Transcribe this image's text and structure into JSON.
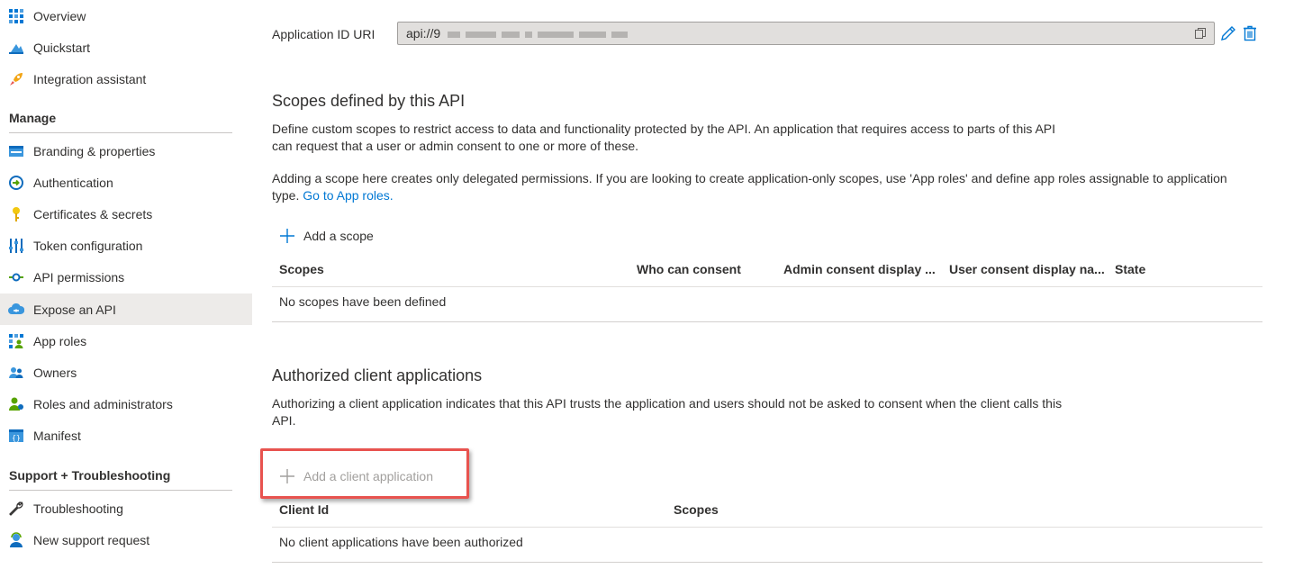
{
  "sidebar": {
    "top_items": [
      {
        "label": "Overview",
        "icon": "overview-icon"
      },
      {
        "label": "Quickstart",
        "icon": "quickstart-icon"
      },
      {
        "label": "Integration assistant",
        "icon": "rocket-icon"
      }
    ],
    "manage_header": "Manage",
    "manage_items": [
      {
        "label": "Branding & properties",
        "icon": "branding-icon"
      },
      {
        "label": "Authentication",
        "icon": "authentication-icon"
      },
      {
        "label": "Certificates & secrets",
        "icon": "key-icon"
      },
      {
        "label": "Token configuration",
        "icon": "token-config-icon"
      },
      {
        "label": "API permissions",
        "icon": "api-permissions-icon"
      },
      {
        "label": "Expose an API",
        "icon": "cloud-api-icon",
        "selected": true
      },
      {
        "label": "App roles",
        "icon": "app-roles-icon"
      },
      {
        "label": "Owners",
        "icon": "owners-icon"
      },
      {
        "label": "Roles and administrators",
        "icon": "roles-admin-icon"
      },
      {
        "label": "Manifest",
        "icon": "manifest-icon"
      }
    ],
    "support_header": "Support + Troubleshooting",
    "support_items": [
      {
        "label": "Troubleshooting",
        "icon": "wrench-icon"
      },
      {
        "label": "New support request",
        "icon": "support-person-icon"
      }
    ]
  },
  "main": {
    "app_id_uri": {
      "label": "Application ID URI",
      "value_prefix": "api://9"
    },
    "scopes": {
      "title": "Scopes defined by this API",
      "description_1": "Define custom scopes to restrict access to data and functionality protected by the API. An application that requires access to parts of this API can request that a user or admin consent to one or more of these.",
      "description_2": "Adding a scope here creates only delegated permissions. If you are looking to create application-only scopes, use 'App roles' and define app roles assignable to application type.",
      "link": "Go to App roles.",
      "add_button": "Add a scope",
      "columns": [
        "Scopes",
        "Who can consent",
        "Admin consent display ...",
        "User consent display na...",
        "State"
      ],
      "empty_text": "No scopes have been defined"
    },
    "clients": {
      "title": "Authorized client applications",
      "description": "Authorizing a client application indicates that this API trusts the application and users should not be asked to consent when the client calls this API.",
      "add_button": "Add a client application",
      "columns": [
        "Client Id",
        "Scopes"
      ],
      "empty_text": "No client applications have been authorized"
    }
  },
  "colors": {
    "accent": "#0078d4",
    "highlight": "#e8534f",
    "selected_bg": "#edebe9"
  }
}
